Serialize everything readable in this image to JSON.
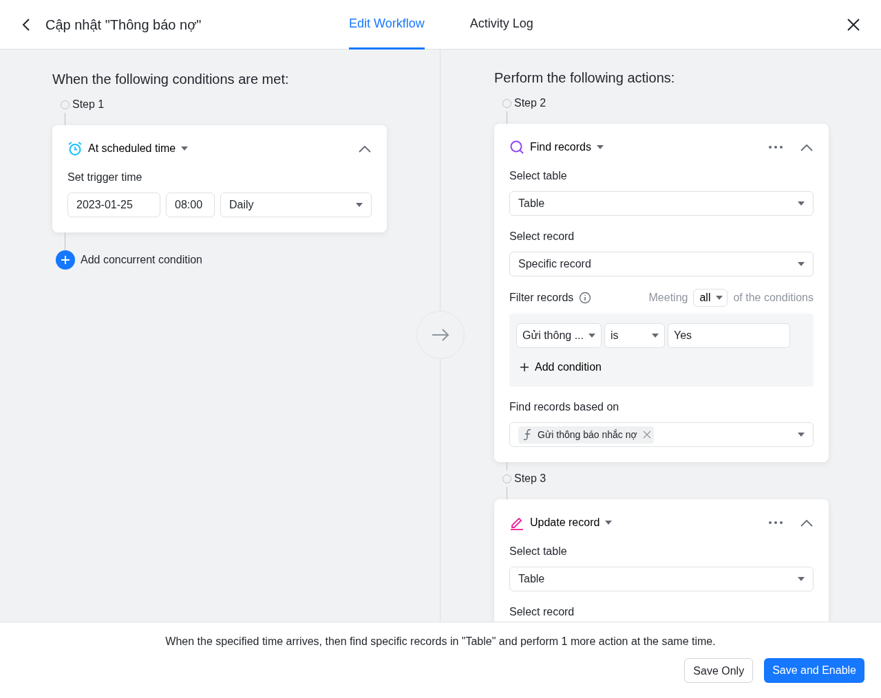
{
  "header": {
    "title": "Cập nhật \"Thông báo nợ\""
  },
  "tabs": [
    {
      "label": "Edit Workflow",
      "selected": true
    },
    {
      "label": "Activity Log",
      "selected": false
    }
  ],
  "conditions": {
    "heading": "When the following conditions are met:",
    "steps": [
      {
        "label": "Step 1",
        "title": "At scheduled time",
        "field_label": "Set trigger time",
        "date": "2023-01-25",
        "time": "08:00",
        "frequency": "Daily"
      }
    ],
    "add_button": "Add concurrent condition"
  },
  "actions": {
    "heading": "Perform the following actions:",
    "steps": [
      {
        "label": "Step 2",
        "kind": "find",
        "title": "Find records",
        "fields": [
          {
            "kind": "select",
            "label": "Select table",
            "value": "Table"
          },
          {
            "kind": "select",
            "label": "Select record",
            "value": "Specific record"
          },
          {
            "kind": "filter",
            "label": "Filter records",
            "meeting": "Meeting",
            "match": "all",
            "suffix": "of the conditions",
            "conditions": [
              {
                "field": "Gửi thông ...",
                "operator": "is",
                "value": "Yes"
              }
            ],
            "add": "Add condition"
          },
          {
            "kind": "tags",
            "label": "Find records based on",
            "tags": [
              "Gửi thông báo nhắc nợ"
            ]
          }
        ]
      },
      {
        "label": "Step 3",
        "kind": "update",
        "title": "Update record",
        "fields": [
          {
            "kind": "select",
            "label": "Select table",
            "value": "Table"
          },
          {
            "kind": "label",
            "label": "Select record"
          }
        ]
      }
    ]
  },
  "footer": {
    "summary": "When the specified time arrives, then find specific records in \"Table\" and perform 1 more action at the same time.",
    "buttons": [
      {
        "label": "Save Only",
        "kind": "secondary"
      },
      {
        "label": "Save and Enable",
        "kind": "primary"
      }
    ]
  }
}
